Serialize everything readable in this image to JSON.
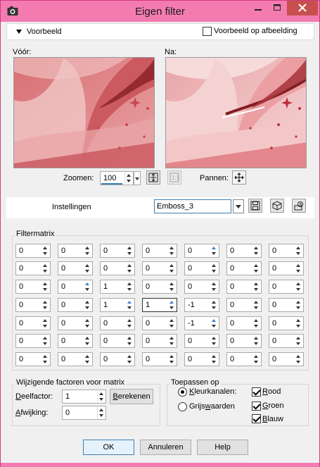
{
  "window": {
    "title": "Eigen filter"
  },
  "colors": {
    "titlebar": "#f47bb0",
    "close": "#c7504f",
    "accent": "#3c7fb1",
    "preview_red": "#d0474f"
  },
  "preview": {
    "toggle_label": "Voorbeeld",
    "on_image_label": "Voorbeeld op afbeelding",
    "on_image_checked": false,
    "before_label": "Vóór:",
    "after_label": "Na:",
    "zoom_label": "Zoomen:",
    "zoom_value": "100",
    "pan_label": "Pannen:"
  },
  "settings": {
    "label": "Instellingen",
    "preset": "Emboss_3"
  },
  "matrix": {
    "title": "Filtermatrix",
    "rows": [
      [
        "0",
        "0",
        "0",
        "0",
        "0",
        "0",
        "0"
      ],
      [
        "0",
        "0",
        "0",
        "0",
        "0",
        "0",
        "0"
      ],
      [
        "0",
        "0",
        "1",
        "0",
        "0",
        "0",
        "0"
      ],
      [
        "0",
        "0",
        "1",
        "1",
        "-1",
        "0",
        "0"
      ],
      [
        "0",
        "0",
        "0",
        "0",
        "-1",
        "0",
        "0"
      ],
      [
        "0",
        "0",
        "0",
        "0",
        "0",
        "0",
        "0"
      ],
      [
        "0",
        "0",
        "0",
        "0",
        "0",
        "0",
        "0"
      ]
    ],
    "active_cell": [
      3,
      3
    ]
  },
  "factors": {
    "title": "Wijzigende factoren voor matrix",
    "divisor_label": "Deelfactor:",
    "divisor_value": "1",
    "calc_button": "Berekenen",
    "bias_label": "Afwijking:",
    "bias_value": "0"
  },
  "apply": {
    "title": "Toepassen op",
    "color_channels": "Kleurkanalen:",
    "grayscale": "Grijswaarden",
    "mode": "color",
    "red": "Rood",
    "red_checked": true,
    "green": "Groen",
    "green_checked": true,
    "blue": "Blauw",
    "blue_checked": true
  },
  "buttons": {
    "ok": "OK",
    "cancel": "Annuleren",
    "help": "Help"
  }
}
